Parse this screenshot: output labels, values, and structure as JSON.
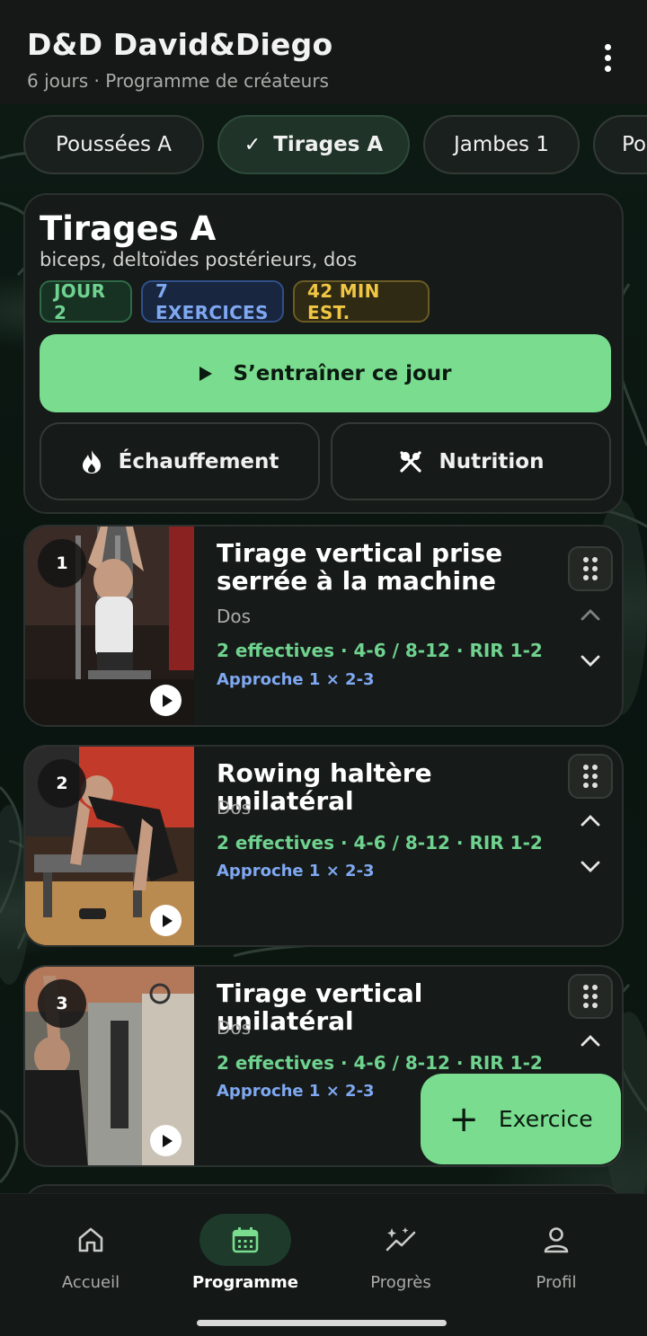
{
  "header": {
    "title": "D&D David&Diego",
    "subtitle": "6 jours · Programme de créateurs",
    "menu_icon": "more-vert-icon"
  },
  "day_tabs": [
    {
      "label": "Poussées A",
      "active": false
    },
    {
      "label": "Tirages A",
      "active": true
    },
    {
      "label": "Jambes 1",
      "active": false
    },
    {
      "label": "Po",
      "active": false
    }
  ],
  "day_summary": {
    "title": "Tirages A",
    "muscles": "biceps, deltoïdes postérieurs, dos",
    "badges": {
      "day": "JOUR 2",
      "exercises": "7 EXERCICES",
      "duration": "42 MIN EST."
    },
    "train_label": "S’entraîner ce jour",
    "warmup_label": "Échauffement",
    "nutrition_label": "Nutrition"
  },
  "exercises": [
    {
      "number": "1",
      "name": "Tirage vertical prise serrée à la machine",
      "muscle": "Dos",
      "sets": "2 effectives · 4-6 / 8-12 · RIR 1-2",
      "approach": "Approche 1 × 2-3"
    },
    {
      "number": "2",
      "name": "Rowing haltère unilatéral",
      "muscle": "Dos",
      "sets": "2 effectives · 4-6 / 8-12 · RIR 1-2",
      "approach": "Approche 1 × 2-3"
    },
    {
      "number": "3",
      "name": "Tirage vertical unilatéral",
      "muscle": "Dos",
      "sets": "2 effectives · 4-6 / 8-12 · RIR 1-2",
      "approach": "Approche 1 × 2-3"
    }
  ],
  "fab": {
    "label": "Exercice",
    "icon": "plus-icon"
  },
  "bottom_nav": [
    {
      "label": "Accueil",
      "icon": "home-icon",
      "active": false
    },
    {
      "label": "Programme",
      "icon": "calendar-icon",
      "active": true
    },
    {
      "label": "Progrès",
      "icon": "sparkle-chart-icon",
      "active": false
    },
    {
      "label": "Profil",
      "icon": "person-icon",
      "active": false
    }
  ],
  "colors": {
    "accent": "#79dc8e",
    "background": "#0c1310",
    "card": "#161a18",
    "green_text": "#6fd28f",
    "blue_text": "#7fa8f2",
    "yellow_text": "#f0c644"
  }
}
